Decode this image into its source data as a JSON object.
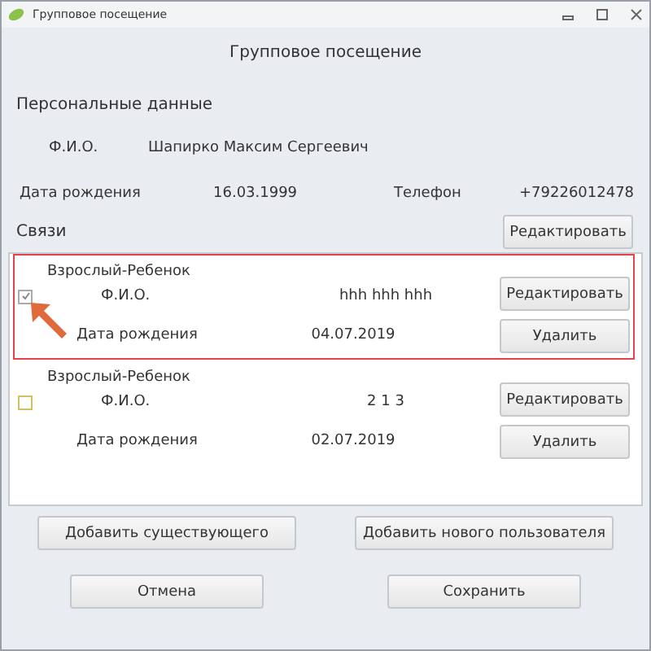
{
  "window": {
    "title": "Групповое посещение"
  },
  "heading": "Групповое посещение",
  "personal": {
    "title": "Персональные данные",
    "name_label": "Ф.И.О.",
    "name": "Шапирко Максим Сергеевич",
    "birth_label": "Дата рождения",
    "birth": "16.03.1999",
    "phone_label": "Телефон",
    "phone": "+79226012478"
  },
  "links": {
    "title": "Связи",
    "edit_button": "Редактировать",
    "items": [
      {
        "category": "Взрослый-Ребенок",
        "checked": true,
        "highlighted": true,
        "name_label": "Ф.И.О.",
        "name": "hhh hhh hhh",
        "birth_label": "Дата рождения",
        "birth": "04.07.2019",
        "edit_button": "Редактировать",
        "delete_button": "Удалить"
      },
      {
        "category": "Взрослый-Ребенок",
        "checked": false,
        "name_label": "Ф.И.О.",
        "name": "2 1 3",
        "birth_label": "Дата рождения",
        "birth": "02.07.2019",
        "edit_button": "Редактировать",
        "delete_button": "Удалить"
      }
    ]
  },
  "buttons": [
    "Добавить существующего",
    "Добавить нового пользователя",
    "Отмена",
    "Сохранить"
  ]
}
